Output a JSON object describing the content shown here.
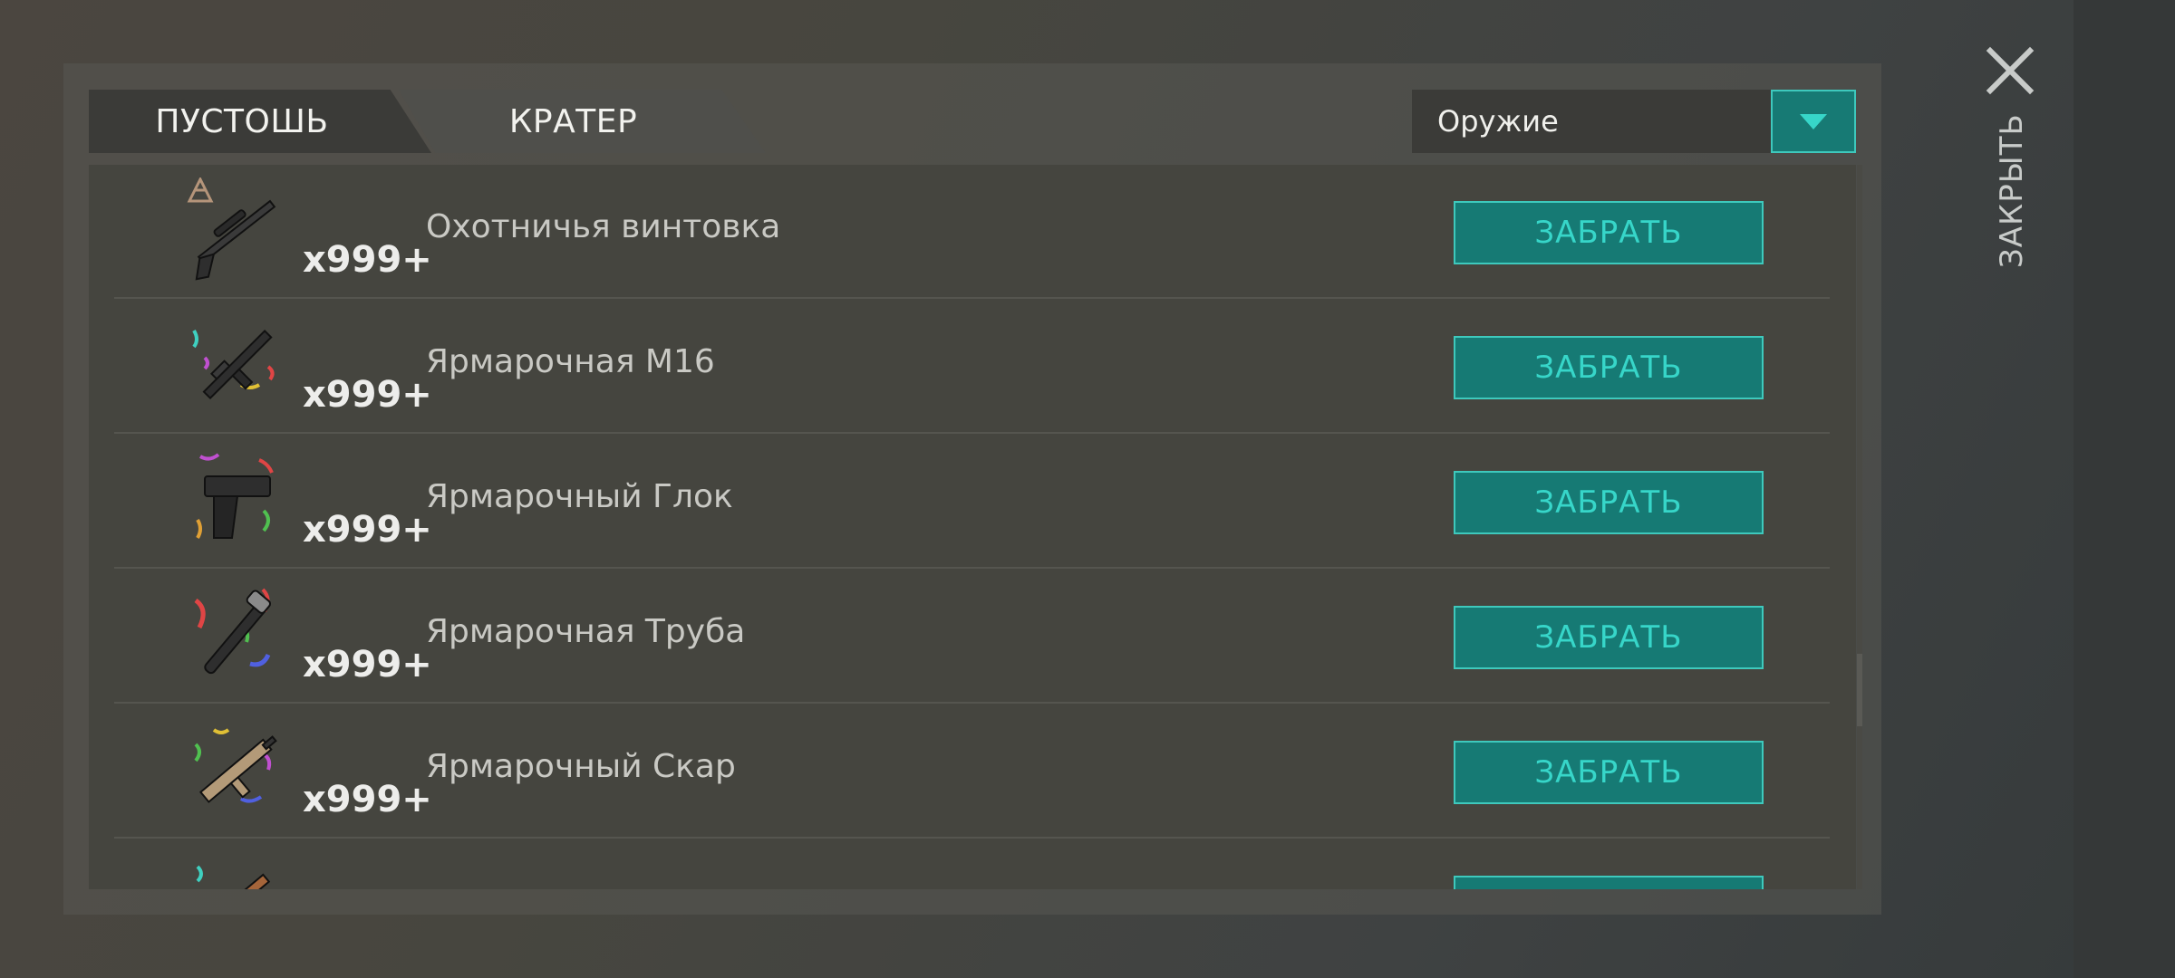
{
  "tabs": [
    {
      "label": "ПУСТОШЬ",
      "active": true
    },
    {
      "label": "КРАТЕР",
      "active": false
    }
  ],
  "filter": {
    "value": "Оружие"
  },
  "close_label": "ЗАКРЫТЬ",
  "items": [
    {
      "name": "Охотничья винтовка",
      "qty": "x999+",
      "button": "ЗАБРАТЬ",
      "icon": "hunting-rifle-icon",
      "badge": "clan-badge-icon"
    },
    {
      "name": "Ярмарочная М16",
      "qty": "x999+",
      "button": "ЗАБРАТЬ",
      "icon": "festive-m16-icon"
    },
    {
      "name": "Ярмарочный Глок",
      "qty": "x999+",
      "button": "ЗАБРАТЬ",
      "icon": "festive-glock-icon"
    },
    {
      "name": "Ярмарочная Труба",
      "qty": "x999+",
      "button": "ЗАБРАТЬ",
      "icon": "festive-pipe-icon"
    },
    {
      "name": "Ярмарочный Скар",
      "qty": "x999+",
      "button": "ЗАБРАТЬ",
      "icon": "festive-scar-icon"
    },
    {
      "name": "",
      "qty": "",
      "button": "",
      "icon": "festive-weapon-icon"
    }
  ],
  "colors": {
    "accent": "#37d6c9",
    "button_bg": "#167a74"
  }
}
